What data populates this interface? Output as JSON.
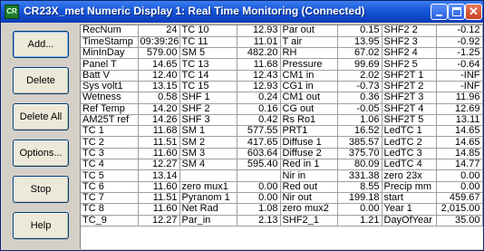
{
  "window": {
    "title": "CR23X_met Numeric Display 1: Real Time Monitoring (Connected)",
    "icon_text": "CR"
  },
  "buttons": [
    {
      "name": "add-button",
      "label": "Add..."
    },
    {
      "name": "delete-button",
      "label": "Delete"
    },
    {
      "name": "delete-all-button",
      "label": "Delete All"
    },
    {
      "name": "options-button",
      "label": "Options..."
    },
    {
      "name": "stop-button",
      "label": "Stop"
    },
    {
      "name": "help-button",
      "label": "Help"
    }
  ],
  "grid": {
    "rows": [
      [
        [
          "RecNum",
          "24"
        ],
        [
          "TC 10",
          "12.93"
        ],
        [
          "Par out",
          "0.15"
        ],
        [
          "SHF2 2",
          "-0.12"
        ]
      ],
      [
        [
          "TimeStamp",
          "09:39:26"
        ],
        [
          "TC 11",
          "11.01"
        ],
        [
          "T air",
          "13.95"
        ],
        [
          "SHF2 3",
          "-0.92"
        ]
      ],
      [
        [
          "MinInDay",
          "579.00"
        ],
        [
          "SM 5",
          "482.20"
        ],
        [
          "RH",
          "67.02"
        ],
        [
          "SHF2 4",
          "-1.25"
        ]
      ],
      [
        [
          "Panel T",
          "14.65"
        ],
        [
          "TC 13",
          "11.68"
        ],
        [
          "Pressure",
          "99.69"
        ],
        [
          "SHF2 5",
          "-0.64"
        ]
      ],
      [
        [
          "Batt V",
          "12.40"
        ],
        [
          "TC 14",
          "12.43"
        ],
        [
          "CM1 in",
          "2.02"
        ],
        [
          "SHF2T 1",
          "-INF"
        ]
      ],
      [
        [
          "Sys volt1",
          "13.15"
        ],
        [
          "TC 15",
          "12.93"
        ],
        [
          "CG1 in",
          "-0.73"
        ],
        [
          "SHF2T 2",
          "-INF"
        ]
      ],
      [
        [
          "Wetness",
          "0.58"
        ],
        [
          "SHF 1",
          "0.24"
        ],
        [
          "CM1 out",
          "0.36"
        ],
        [
          "SHF2T 3",
          "11.96"
        ]
      ],
      [
        [
          "Ref Temp",
          "14.20"
        ],
        [
          "SHF 2",
          "0.16"
        ],
        [
          "CG out",
          "-0.05"
        ],
        [
          "SHF2T 4",
          "12.69"
        ]
      ],
      [
        [
          "AM25T ref",
          "14.26"
        ],
        [
          "SHF 3",
          "0.42"
        ],
        [
          "Rs Ro1",
          "1.06"
        ],
        [
          "SHF2T 5",
          "13.11"
        ]
      ],
      [
        [
          "TC 1",
          "11.68"
        ],
        [
          "SM 1",
          "577.55"
        ],
        [
          "PRT1",
          "16.52"
        ],
        [
          "LedTC 1",
          "14.65"
        ]
      ],
      [
        [
          "TC 2",
          "11.51"
        ],
        [
          "SM 2",
          "417.65"
        ],
        [
          "Diffuse 1",
          "385.57"
        ],
        [
          "LedTC 2",
          "14.65"
        ]
      ],
      [
        [
          "TC 3",
          "11.60"
        ],
        [
          "SM 3",
          "603.64"
        ],
        [
          "Diffuse 2",
          "375.70"
        ],
        [
          "LedTC 3",
          "14.85"
        ]
      ],
      [
        [
          "TC 4",
          "12.27"
        ],
        [
          "SM 4",
          "595.40"
        ],
        [
          "Red in 1",
          "80.09"
        ],
        [
          "LedTC 4",
          "14.77"
        ]
      ],
      [
        [
          "TC 5",
          "13.14"
        ],
        [
          "",
          ""
        ],
        [
          "Nir in",
          "331.38"
        ],
        [
          "zero 23x",
          "0.00"
        ]
      ],
      [
        [
          "TC 6",
          "11.60"
        ],
        [
          "zero mux1",
          "0.00"
        ],
        [
          "Red out",
          "8.55"
        ],
        [
          "Precip mm",
          "0.00"
        ]
      ],
      [
        [
          "TC 7",
          "11.51"
        ],
        [
          "Pyranom 1",
          "0.00"
        ],
        [
          "Nir out",
          "199.18"
        ],
        [
          "start",
          "459.67"
        ]
      ],
      [
        [
          "TC 8",
          "11.60"
        ],
        [
          "Net Rad",
          "1.08"
        ],
        [
          "zero mux2",
          "0.00"
        ],
        [
          "Year 1",
          "2,015.00"
        ]
      ],
      [
        [
          "TC_9",
          "12.27"
        ],
        [
          "Par_in",
          "2.13"
        ],
        [
          "SHF2_1",
          "1.21"
        ],
        [
          "DayOfYear",
          "35.00"
        ]
      ]
    ]
  }
}
